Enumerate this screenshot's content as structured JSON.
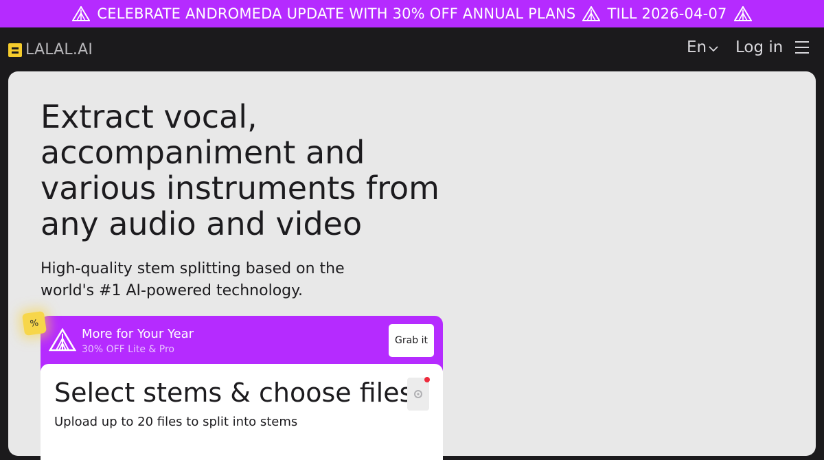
{
  "promo": {
    "text": "CELEBRATE ANDROMEDA UPDATE WITH 30% OFF ANNUAL PLANS",
    "till": "TILL 2026-04-07",
    "bg_color": "#b52bff"
  },
  "header": {
    "logo_text": "LALAL.AI",
    "language": "En",
    "login_label": "Log in",
    "menu_icon": "hamburger-icon"
  },
  "hero": {
    "headline": "Extract vocal, accompaniment and various instruments from any audio and video",
    "subheadline": "High-quality stem splitting based on the world's #1 AI-powered technology.",
    "badge": "%"
  },
  "offer": {
    "title": "More for Your Year",
    "subtitle": "30% OFF Lite & Pro",
    "button_label": "Grab it",
    "icon": "andromeda-logo-icon"
  },
  "upload": {
    "title": "Select stems & choose files",
    "subtitle": "Upload up to 20 files to split into stems",
    "settings_icon": "settings-icon"
  },
  "colors": {
    "accent": "#b52bff",
    "brand_yellow": "#f5cc2c",
    "page_bg": "#1b1a1c",
    "hero_bg": "#e8e8e8",
    "notification": "#ee2a3c"
  }
}
